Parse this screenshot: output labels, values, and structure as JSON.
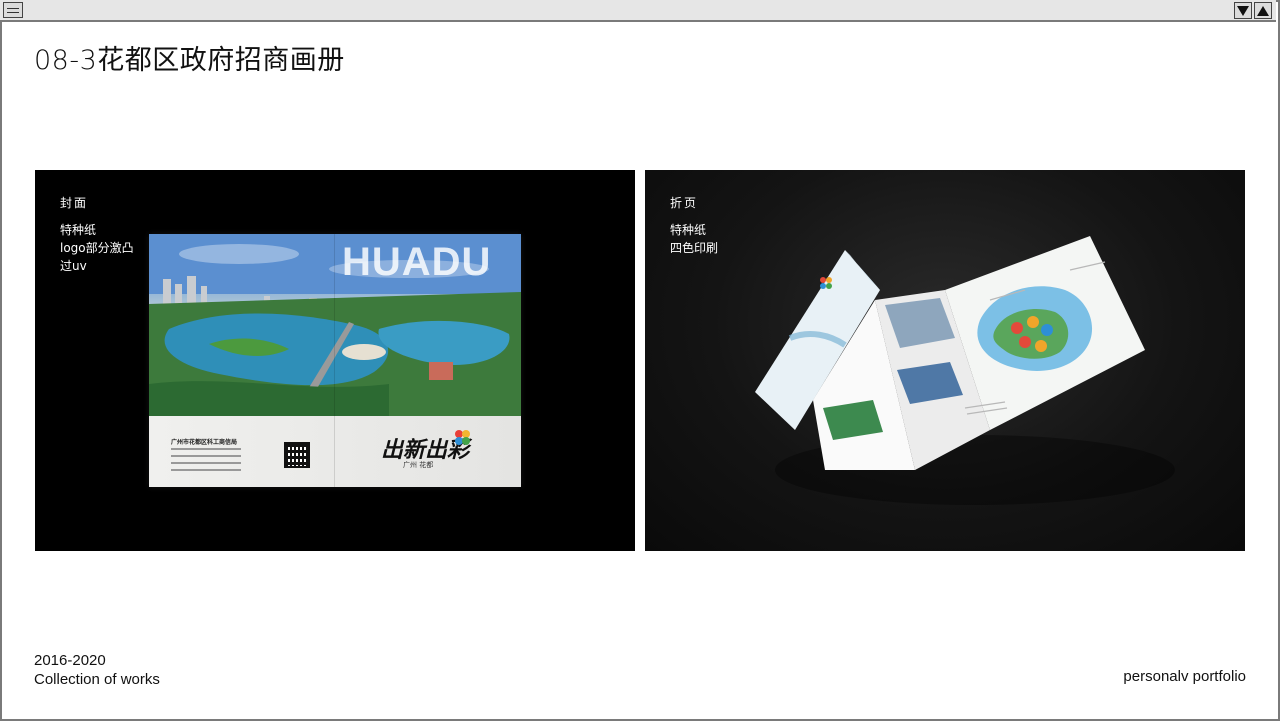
{
  "page": {
    "title": "08-3花都区政府招商画册"
  },
  "panels": {
    "left": {
      "heading": "封面",
      "lines": [
        "特种纸",
        "logo部分激凸",
        "过uv"
      ],
      "mockup": {
        "cover_title": "HUADU",
        "footer_company": "广州市花都区科工商信局",
        "slogan": "出新出彩",
        "slogan_sub": "广州 花都"
      }
    },
    "right": {
      "heading": "折页",
      "lines": [
        "特种纸",
        "四色印刷"
      ]
    }
  },
  "footer": {
    "years": "2016-2020",
    "collection": "Collection of works",
    "portfolio": "personalv portfolio"
  },
  "colors": {
    "panel_bg": "#000000",
    "accent_blue": "#4b7fc4"
  },
  "icons": {
    "window_menu": "menu-icon",
    "minimize": "triangle-down-icon",
    "maximize": "triangle-up-icon"
  }
}
